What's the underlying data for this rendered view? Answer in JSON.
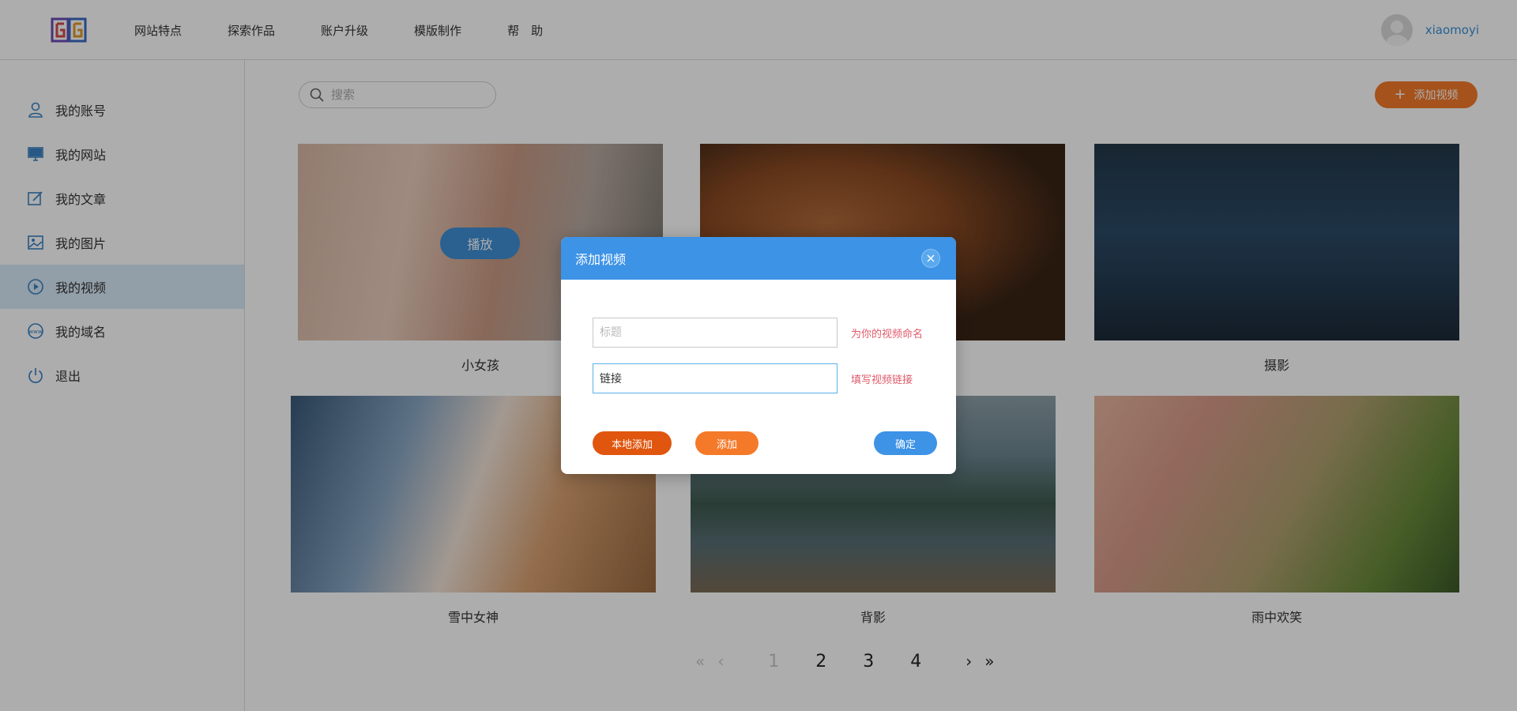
{
  "header": {
    "nav": [
      "网站特点",
      "探索作品",
      "账户升级",
      "模版制作",
      "帮　助"
    ],
    "username": "xiaomoyi"
  },
  "sidebar": {
    "items": [
      {
        "label": "我的账号",
        "icon": "user-icon"
      },
      {
        "label": "我的网站",
        "icon": "monitor-icon"
      },
      {
        "label": "我的文章",
        "icon": "edit-icon"
      },
      {
        "label": "我的图片",
        "icon": "image-icon"
      },
      {
        "label": "我的视频",
        "icon": "play-circle-icon",
        "active": true
      },
      {
        "label": "我的域名",
        "icon": "www-icon"
      },
      {
        "label": "退出",
        "icon": "power-icon"
      }
    ]
  },
  "main": {
    "search_placeholder": "搜索",
    "add_video_label": "添加视频",
    "play_label": "播放",
    "videos": [
      {
        "title": "小女孩"
      },
      {
        "title": ""
      },
      {
        "title": "摄影"
      },
      {
        "title": "雪中女神"
      },
      {
        "title": "背影"
      },
      {
        "title": "雨中欢笑"
      }
    ]
  },
  "pagination": {
    "pages": [
      "1",
      "2",
      "3",
      "4"
    ],
    "current": "1",
    "first": "«",
    "prev": "‹",
    "next": "›",
    "last": "»"
  },
  "dialog": {
    "title": "添加视频",
    "title_placeholder": "标题",
    "title_hint": "为你的视频命名",
    "link_value": "链接",
    "link_hint": "填写视频链接",
    "btn_local": "本地添加",
    "btn_add": "添加",
    "btn_ok": "确定"
  },
  "colors": {
    "primary": "#3d93e6",
    "accent_orange": "#f47a2a",
    "accent_dark_orange": "#e0560e",
    "hint_red": "#e05a6a"
  }
}
